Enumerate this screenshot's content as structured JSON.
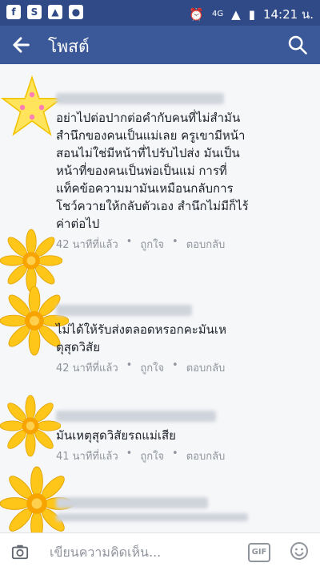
{
  "statusbar": {
    "network": "4G",
    "time": "14:21 น."
  },
  "appbar": {
    "title": "โพสต์"
  },
  "comments": [
    {
      "lines": [
        "อย่าไปต่อปากต่อคำกับคนที่ไม่สำมัน",
        "สำนึกของคนเป็นแม่เลย ครูเขามีหน้า",
        "สอนไม่ใช่มีหน้าที่ไปรับไปส่ง มันเป็น",
        "หน้าที่ของคนเป็นพ่อเป็นแม่ การที่",
        "แท็คข้อความมามันเหมือนกลับการ",
        "โชว์ควายให้กลับตัวเอง สำนึกไม่มีก็ไร้",
        "ค่าต่อไป"
      ],
      "time": "42 นาทีที่แล้ว",
      "like": "ถูกใจ",
      "reply": "ตอบกลับ"
    },
    {
      "lines": [
        "ไม่ได้ให้รับส่งตลอดหรอกคะมันเห",
        "ตุสุดวิสัย"
      ],
      "time": "42 นาทีที่แล้ว",
      "like": "ถูกใจ",
      "reply": "ตอบกลับ"
    },
    {
      "lines": [
        "มันเหตุสุดวิสัยรถแม่เสีย"
      ],
      "time": "41 นาทีที่แล้ว",
      "like": "ถูกใจ",
      "reply": "ตอบกลับ"
    }
  ],
  "composer": {
    "placeholder": "เขียนความคิดเห็น..."
  },
  "icons": {
    "back": "arrow-left-icon",
    "search": "search-icon",
    "camera": "camera-icon",
    "gif": "GIF",
    "emoji": "emoji-icon"
  },
  "colors": {
    "appbar": "#3b5998",
    "statusbar": "#2f4a86",
    "meta": "#90949c"
  }
}
